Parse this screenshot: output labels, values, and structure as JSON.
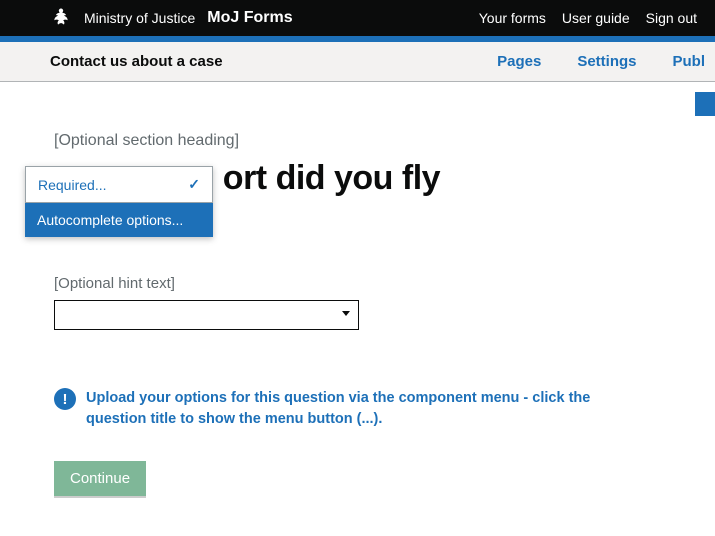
{
  "header": {
    "ministry": "Ministry of Justice",
    "product": "MoJ Forms",
    "links": {
      "your_forms": "Your forms",
      "user_guide": "User guide",
      "sign_out": "Sign out"
    }
  },
  "form": {
    "title": "Contact us about a case"
  },
  "tabs": {
    "pages": "Pages",
    "settings": "Settings",
    "publish": "Publ"
  },
  "page": {
    "section_heading": "[Optional section heading]",
    "question_title_visible": "ort did you fly",
    "hint": "[Optional hint text]",
    "info": "Upload your options for this question via the component menu - click the question title to show the menu button (...).",
    "continue": "Continue"
  },
  "menu": {
    "required": "Required...",
    "autocomplete": "Autocomplete options..."
  }
}
